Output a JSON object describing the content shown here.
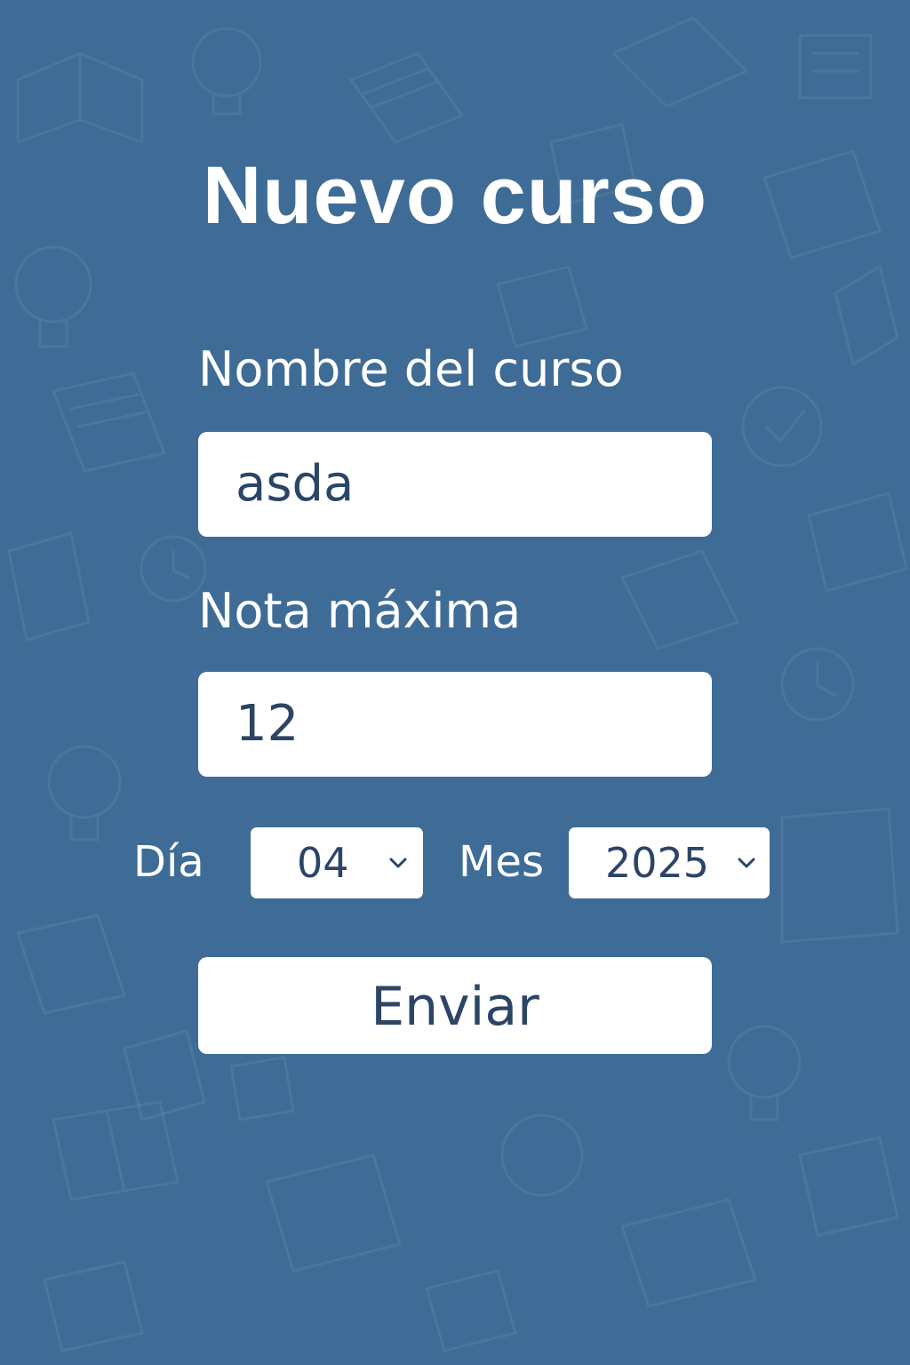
{
  "theme": {
    "background": "#3e6c96",
    "field_text": "#2b4566",
    "label_text": "#ffffff"
  },
  "form": {
    "title": "Nuevo curso",
    "course_name": {
      "label": "Nombre del curso",
      "value": "asda"
    },
    "max_grade": {
      "label": "Nota máxima",
      "value": "12"
    },
    "day": {
      "label": "Día",
      "selected": "04",
      "icon": "chevron-down-icon"
    },
    "month": {
      "label": "Mes",
      "selected": "2025",
      "icon": "chevron-down-icon"
    },
    "submit_label": "Enviar"
  }
}
